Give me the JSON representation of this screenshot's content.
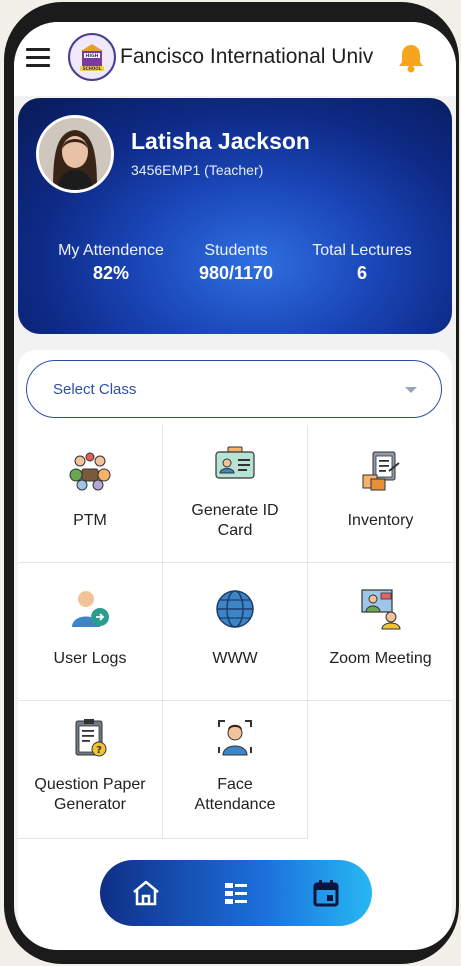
{
  "app": {
    "title": "Fancisco International Univ",
    "logo_text_top": "HIGH",
    "logo_text_bottom": "SCHOOL"
  },
  "profile": {
    "name": "Latisha Jackson",
    "employee_id": "3456EMP1 (Teacher)",
    "stats": [
      {
        "label": "My Attendence",
        "value": "82%"
      },
      {
        "label": "Students",
        "value": "980/1170"
      },
      {
        "label": "Total Lectures",
        "value": "6"
      }
    ]
  },
  "select_class": {
    "label": "Select Class"
  },
  "menu": {
    "ptm": "PTM",
    "generate_id_card": [
      "Generate ID",
      "Card"
    ],
    "inventory": "Inventory",
    "user_logs": "User Logs",
    "www": "WWW",
    "zoom_meeting": "Zoom Meeting",
    "question_paper": [
      "Question Paper",
      "Generator"
    ],
    "face_attendance": [
      "Face",
      "Attendance"
    ]
  },
  "icons": {
    "menu": "hamburger-icon",
    "notification": "bell-icon",
    "home": "home-icon",
    "list": "list-icon",
    "calendar": "calendar-icon"
  },
  "colors": {
    "accent": "#2e4fa6",
    "bell": "#f7a51c",
    "card_dark": "#0e2a86"
  }
}
